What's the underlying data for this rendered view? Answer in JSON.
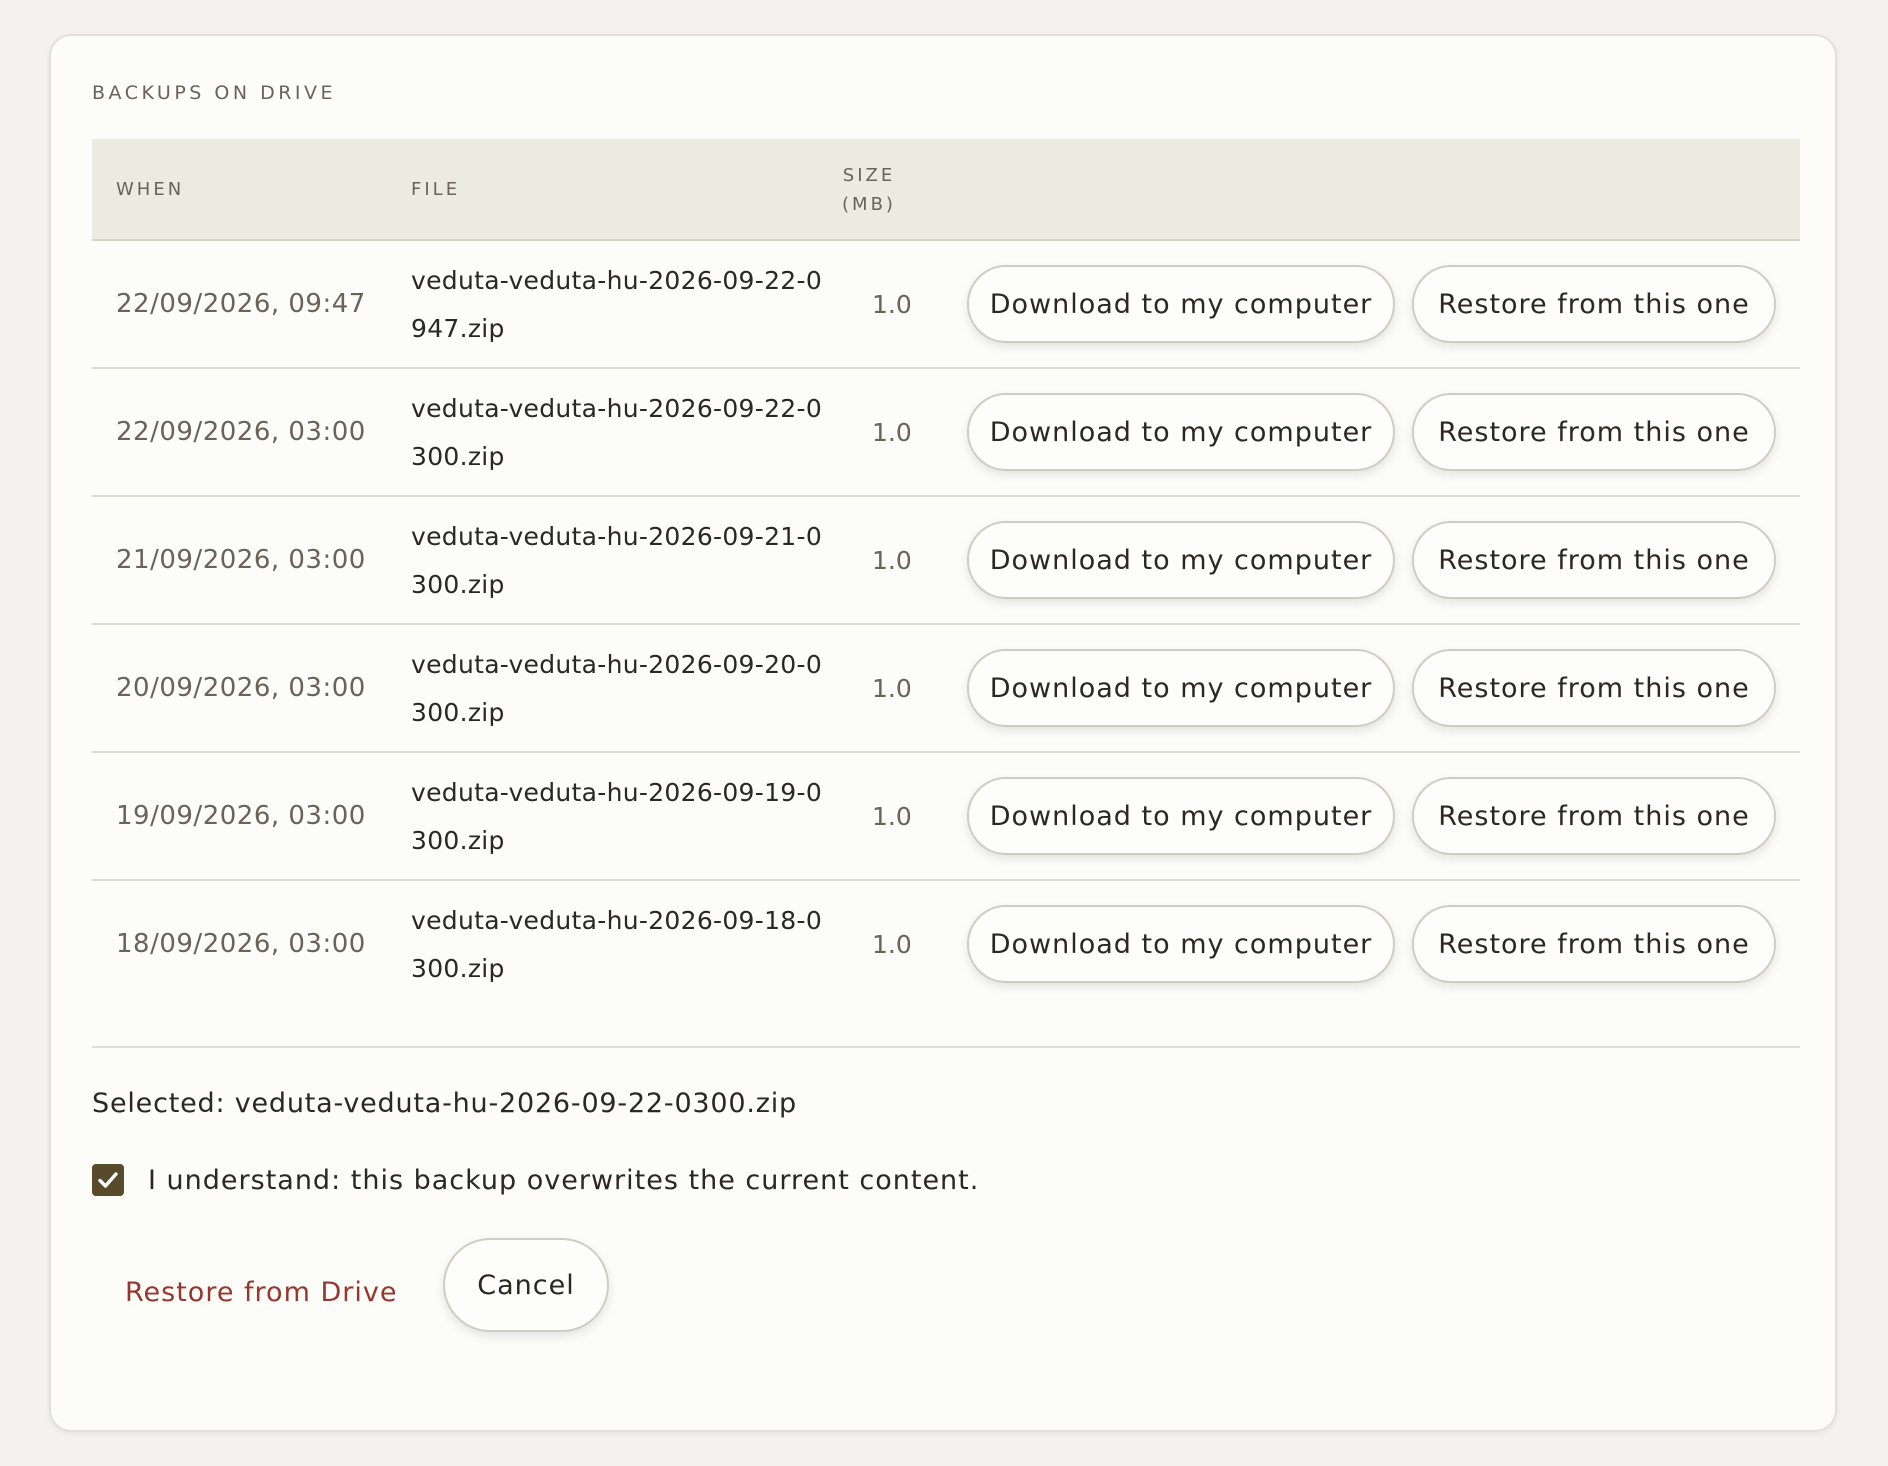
{
  "section_title": "BACKUPS ON DRIVE",
  "table": {
    "headers": {
      "when": "WHEN",
      "file": "FILE",
      "size_line1": "SIZE",
      "size_line2": "(MB)"
    },
    "rows": [
      {
        "when": "22/09/2026, 09:47",
        "file": "veduta-veduta-hu-2026-09-22-0947.zip",
        "size": "1.0",
        "download_label": "Download to my computer",
        "restore_label": "Restore from this one"
      },
      {
        "when": "22/09/2026, 03:00",
        "file": "veduta-veduta-hu-2026-09-22-0300.zip",
        "size": "1.0",
        "download_label": "Download to my computer",
        "restore_label": "Restore from this one"
      },
      {
        "when": "21/09/2026, 03:00",
        "file": "veduta-veduta-hu-2026-09-21-0300.zip",
        "size": "1.0",
        "download_label": "Download to my computer",
        "restore_label": "Restore from this one"
      },
      {
        "when": "20/09/2026, 03:00",
        "file": "veduta-veduta-hu-2026-09-20-0300.zip",
        "size": "1.0",
        "download_label": "Download to my computer",
        "restore_label": "Restore from this one"
      },
      {
        "when": "19/09/2026, 03:00",
        "file": "veduta-veduta-hu-2026-09-19-0300.zip",
        "size": "1.0",
        "download_label": "Download to my computer",
        "restore_label": "Restore from this one"
      },
      {
        "when": "18/09/2026, 03:00",
        "file": "veduta-veduta-hu-2026-09-18-0300.zip",
        "size": "1.0",
        "download_label": "Download to my computer",
        "restore_label": "Restore from this one"
      }
    ]
  },
  "selected_text": "Selected: veduta-veduta-hu-2026-09-22-0300.zip",
  "confirm": {
    "checked": true,
    "label": "I understand: this backup overwrites the current content."
  },
  "footer": {
    "restore_drive_label": "Restore from Drive",
    "cancel_label": "Cancel"
  },
  "colors": {
    "accent_danger": "#96362c",
    "checkbox_fill": "#5a4a2c",
    "header_bg": "#ecebe2"
  },
  "icons": {
    "checkbox": "check-icon"
  }
}
